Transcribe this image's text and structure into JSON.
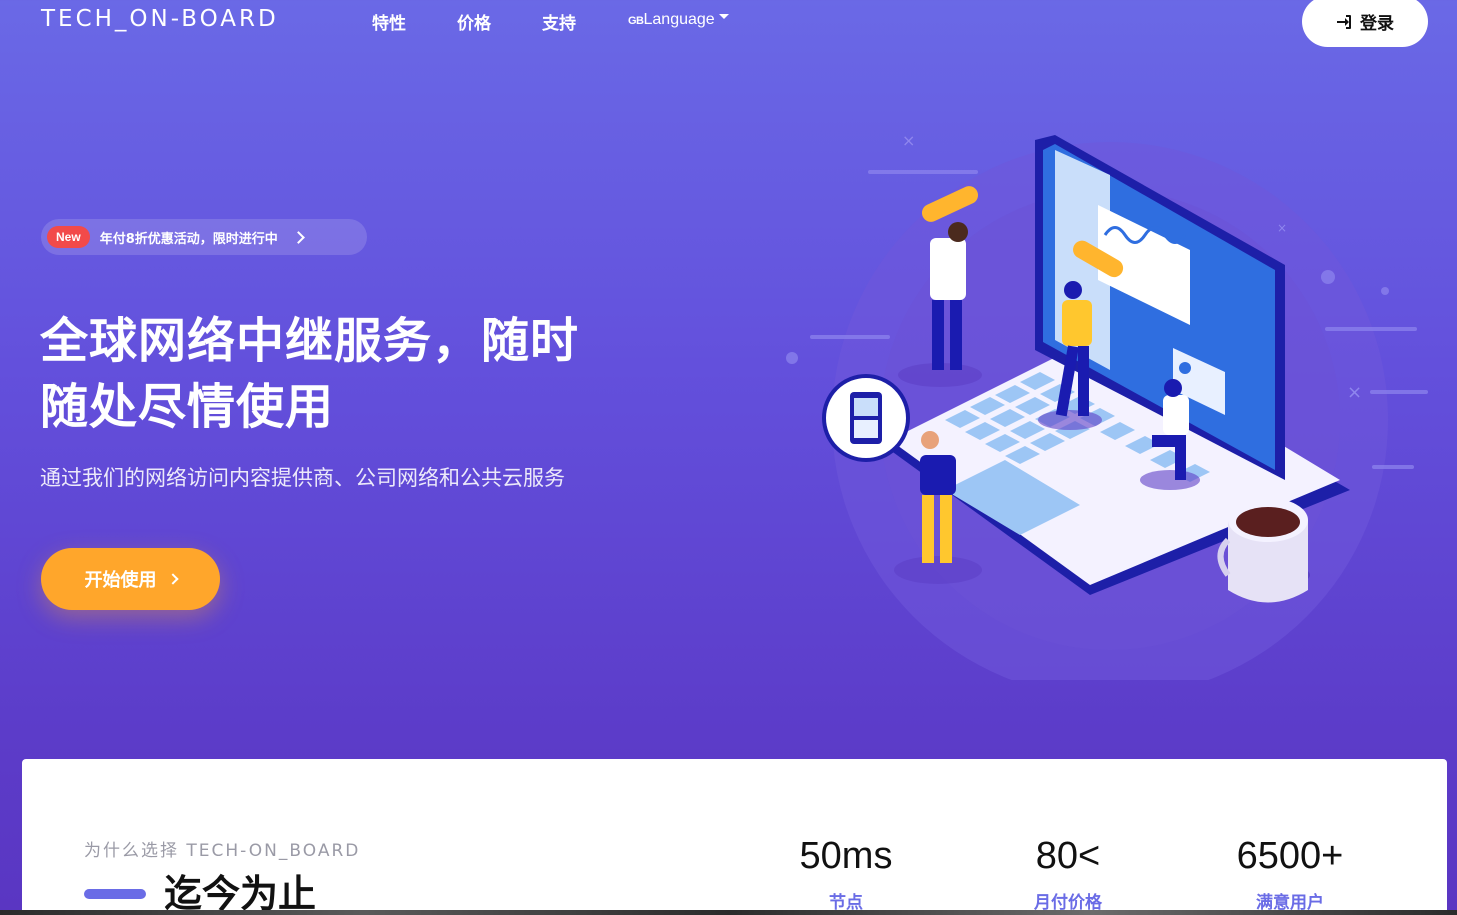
{
  "nav": {
    "brand": "TECH_ON-BOARD",
    "links": [
      "特性",
      "价格",
      "支持"
    ],
    "language_flag": "GB",
    "language_label": "Language",
    "login_label": "登录"
  },
  "promo": {
    "badge": "New",
    "text": "年付8折优惠活动，限时进行中"
  },
  "hero": {
    "title_line1": "全球网络中继服务，随时",
    "title_line2": "随处尽情使用",
    "subtitle": "通过我们的网络访问内容提供商、公司网络和公共云服务",
    "cta_label": "开始使用"
  },
  "why": {
    "eyebrow": "为什么选择 TECH-ON_BOARD",
    "title": "迄今为止",
    "stats": [
      {
        "value": "50ms",
        "label": "节点"
      },
      {
        "value": "80<",
        "label": "月付价格"
      },
      {
        "value": "6500+",
        "label": "满意用户"
      }
    ]
  },
  "colors": {
    "accent": "#6a6ce6",
    "cta": "#ffa62b",
    "badge": "#f24a4a"
  },
  "icons": {
    "login": "sign-in-icon",
    "promo_arrow": "chevron-right-icon",
    "cta_arrow": "chevron-right-icon",
    "language": "caret-down-icon"
  }
}
